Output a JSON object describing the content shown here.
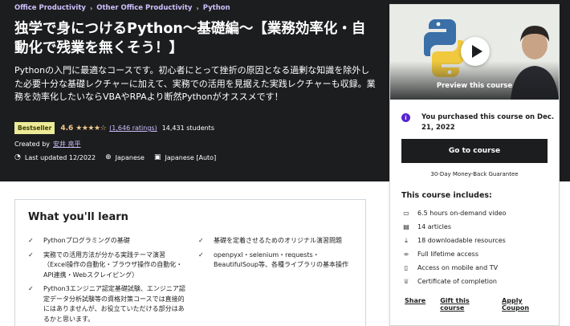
{
  "breadcrumb": [
    "Office Productivity",
    "Other Office Productivity",
    "Python"
  ],
  "title": "独学で身につけるPython〜基礎編〜【業務効率化・自動化で残業を無くそう！】",
  "subtitle": "Pythonの入門に最適なコースです。初心者にとって挫折の原因となる過剰な知識を除外した必要十分な基礎レクチャーに加えて、実務での活用を見据えた実践レクチャーも収録。業務を効率化したいならVBAやRPAより断然Pythonがオススメです！",
  "rating": {
    "badge": "Bestseller",
    "value": "4.6",
    "stars": "★★★★☆",
    "count": "(1,646 ratings)",
    "students": "14,431 students"
  },
  "created": {
    "label": "Created by",
    "author": "安井 亮平"
  },
  "meta": {
    "updated": "Last updated 12/2022",
    "language": "Japanese",
    "captions": "Japanese [Auto]"
  },
  "card": {
    "preview_label": "Preview this course",
    "purchased": "You purchased this course on Dec. 21, 2022",
    "go_button": "Go to course",
    "guarantee": "30-Day Money-Back Guarantee",
    "includes_title": "This course includes:",
    "includes": [
      {
        "icon": "video-icon",
        "glyph": "▭",
        "text": "6.5 hours on-demand video"
      },
      {
        "icon": "article-icon",
        "glyph": "▤",
        "text": "14 articles"
      },
      {
        "icon": "download-icon",
        "glyph": "⤓",
        "text": "18 downloadable resources"
      },
      {
        "icon": "infinity-icon",
        "glyph": "∞",
        "text": "Full lifetime access"
      },
      {
        "icon": "mobile-icon",
        "glyph": "▯",
        "text": "Access on mobile and TV"
      },
      {
        "icon": "certificate-icon",
        "glyph": "♕",
        "text": "Certificate of completion"
      }
    ],
    "actions": {
      "share": "Share",
      "gift": "Gift this course",
      "coupon": "Apply Coupon"
    }
  },
  "learn": {
    "title": "What you'll learn",
    "left": [
      "Pythonプログラミングの基礎",
      "実務での活用方法が分かる実践テーマ演習（Excel操作の自動化・ブラウザ操作の自動化・API連携・Webスクレイピング）",
      "Python3エンジニア認定基礎試験、エンジニア認定データ分析試験等の資格対策コースでは直接的にはありませんが、お役立ていただける部分はあるかと思います。"
    ],
    "right": [
      "基礎を定着させるためのオリジナル演習問題",
      "openpyxl・selenium・requests・BeautifulSoup等、各種ライブラリの基本操作"
    ]
  },
  "colors": {
    "hero_bg": "#1c1d1f",
    "link_purple": "#cec0fc",
    "star_gold": "#f3ca8c",
    "badge_bg": "#eceb98",
    "accent": "#5624d0"
  }
}
